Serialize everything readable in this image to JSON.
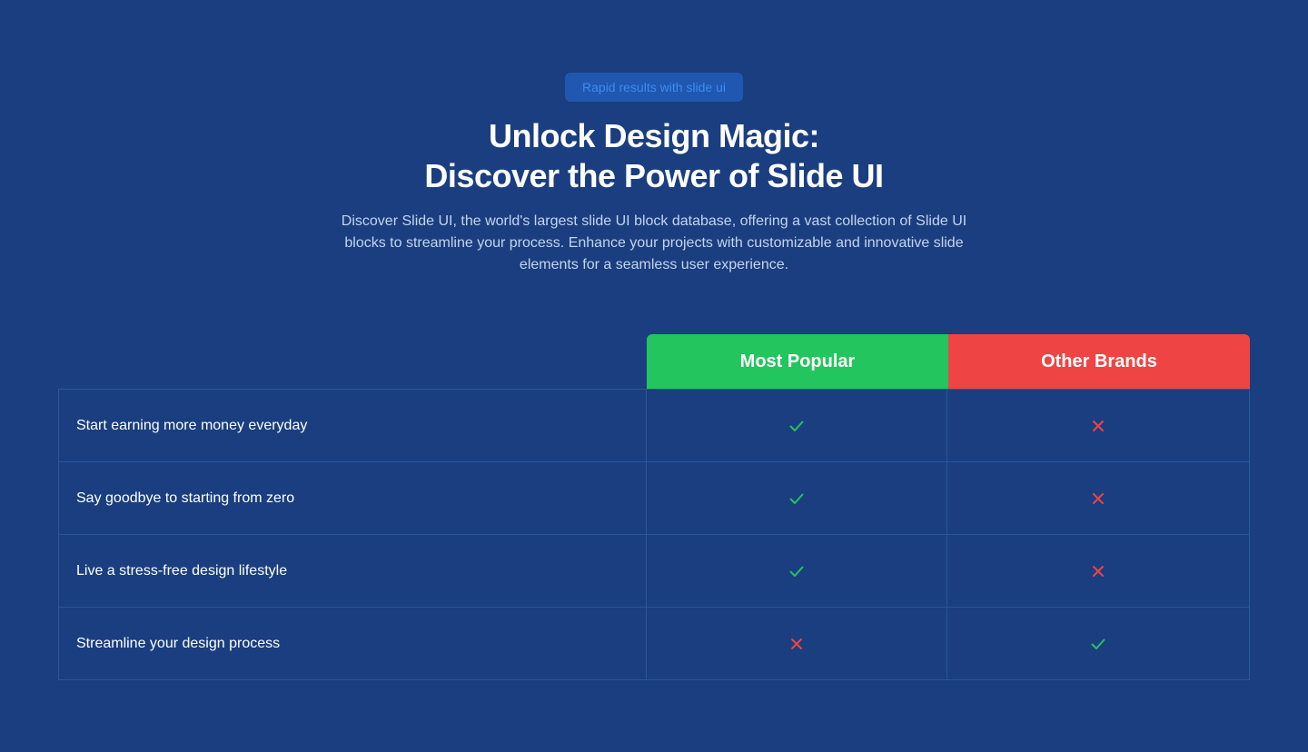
{
  "header": {
    "badge": "Rapid results with slide ui",
    "title_line1": "Unlock Design Magic:",
    "title_line2": "Discover the Power of Slide UI",
    "description": "Discover Slide UI, the world's largest slide UI block database, offering a vast collection of Slide UI blocks to streamline your process. Enhance your projects with customizable and innovative slide elements for a seamless user experience."
  },
  "comparison": {
    "columns": [
      "Most Popular",
      "Other Brands"
    ],
    "rows": [
      {
        "feature": "Start earning more money everyday",
        "popular": "check-icon",
        "other": "cross-icon"
      },
      {
        "feature": "Say goodbye to starting from zero",
        "popular": "check-icon",
        "other": "cross-icon"
      },
      {
        "feature": "Live a stress-free design lifestyle",
        "popular": "check-icon",
        "other": "cross-icon"
      },
      {
        "feature": "Streamline your design process",
        "popular": "cross-icon",
        "other": "check-icon"
      }
    ]
  },
  "colors": {
    "background": "#1a3e7f",
    "popular": "#22c55e",
    "other": "#ef4444",
    "check": "#22c55e",
    "cross": "#ef4444"
  }
}
